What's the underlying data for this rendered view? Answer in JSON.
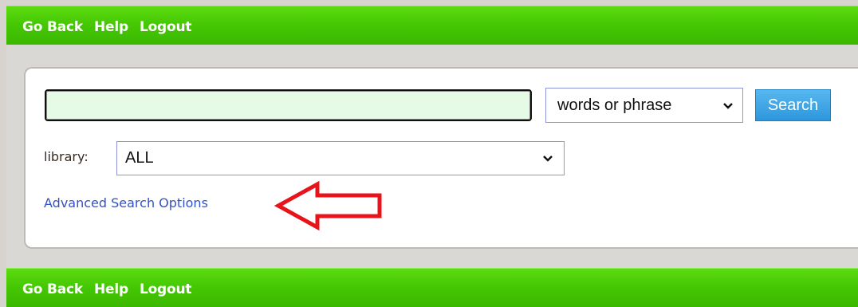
{
  "nav": {
    "links": [
      "Go Back",
      "Help",
      "Logout"
    ]
  },
  "search": {
    "query_value": "",
    "query_placeholder": "",
    "type_value": "words or phrase",
    "button_label": "Search"
  },
  "library": {
    "label": "library:",
    "value": "ALL"
  },
  "advanced_link": "Advanced Search Options",
  "annotation": {
    "arrow_color": "#e8141c"
  },
  "colors": {
    "nav_green": "#46c804",
    "button_blue": "#2d97dc",
    "link_blue": "#3351c8"
  }
}
